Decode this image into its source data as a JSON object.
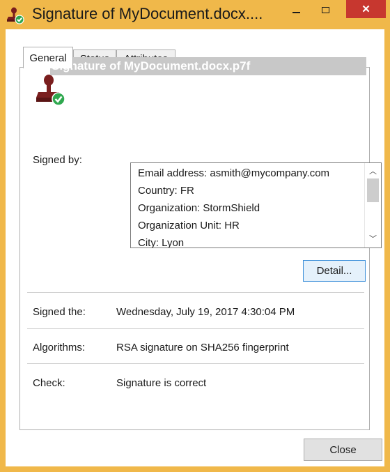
{
  "window": {
    "title": "Signature of MyDocument.docx....",
    "minimize_icon": "minimize-icon",
    "maximize_icon": "maximize-icon",
    "close_icon": "close-icon",
    "close_glyph": "✕"
  },
  "tabs": [
    {
      "label": "General",
      "active": true
    },
    {
      "label": "Status",
      "active": false
    },
    {
      "label": "Attributes",
      "active": false
    }
  ],
  "general": {
    "file_title": "Signature of MyDocument.docx.p7f",
    "signed_by_label": "Signed by:",
    "signer_lines": [
      "Email address: asmith@mycompany.com",
      "Country: FR",
      "Organization: StormShield",
      "Organization Unit: HR",
      "City: Lyon"
    ],
    "detail_button": "Detail...",
    "signed_the_label": "Signed the:",
    "signed_the_value": "Wednesday, July 19, 2017 4:30:04 PM",
    "algorithms_label": "Algorithms:",
    "algorithms_value": "RSA signature on SHA256 fingerprint",
    "check_label": "Check:",
    "check_value": "Signature is correct"
  },
  "footer": {
    "close_button": "Close"
  },
  "colors": {
    "title_bar": "#f0b84a",
    "close_button": "#c7372f",
    "accent_border": "#3c8fd9",
    "stamp": "#7a1e1e",
    "check": "#2fa84f"
  }
}
